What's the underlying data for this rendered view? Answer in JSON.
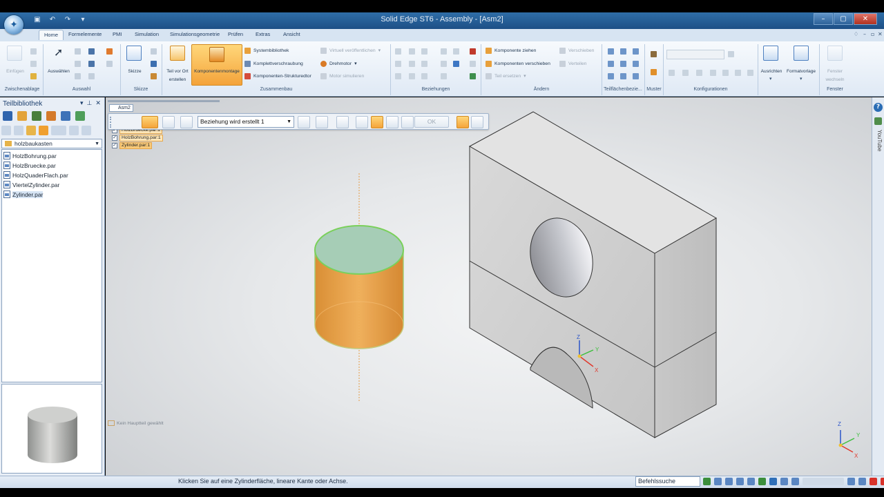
{
  "window": {
    "title": "Solid Edge ST6 - Assembly - [Asm2]",
    "controls": [
      "minimize",
      "maximize",
      "close"
    ]
  },
  "ribbon": {
    "tabs": [
      "Home",
      "Formelemente",
      "PMI",
      "Simulation",
      "Simulationsgeometrie",
      "Prüfen",
      "Extras",
      "Ansicht"
    ],
    "active_tab": "Home",
    "groups": {
      "zwischenablage": {
        "label": "Zwischenablage",
        "paste": "Einfügen"
      },
      "auswahl": {
        "label": "Auswahl",
        "select": "Auswählen"
      },
      "skizze": {
        "label": "Skizze",
        "sketch": "Skizze"
      },
      "zusammenbau": {
        "label": "Zusammenbau",
        "teil_vor_ort_line1": "Teil vor Ort",
        "teil_vor_ort_line2": "erstellen",
        "komponentenmontage": "Komponentenmontage",
        "systembibliothek": "Systembibliothek",
        "komplettverschraubung": "Komplettverschraubung",
        "komponenten_strukturedtor": "Komponenten-Strukturedtor",
        "virtuell": "Virtuell veröffentlichen",
        "drehmotor": "Drehmotor",
        "motor_simulieren": "Motor simulieren"
      },
      "beziehungen": {
        "label": "Beziehungen"
      },
      "aendern": {
        "label": "Ändern",
        "komponente_ziehen": "Komponente ziehen",
        "komponenten_verschieben": "Komponenten verschieben",
        "teil_ersetzen": "Teil ersetzen",
        "verschieben": "Verschieben",
        "verteilen": "Verteilen"
      },
      "teilflaechen": {
        "label": "Teilflächenbezie..."
      },
      "muster": {
        "label": "Muster"
      },
      "konfigurationen": {
        "label": "Konfigurationen"
      },
      "ausrichten": {
        "label": "Ausrichten"
      },
      "formatvorlage": {
        "label": "Formatvorlage"
      },
      "fenster": {
        "label": "Fenster",
        "wechseln_line1": "Fenster",
        "wechseln_line2": "wechseln"
      }
    }
  },
  "library_panel": {
    "title": "Teilbibliothek",
    "folder": "holzbaukasten",
    "files": [
      "HolzBohrung.par",
      "HolzBruecke.par",
      "HolzQuaderFlach.par",
      "ViertelZylinder.par",
      "Zylinder.par"
    ],
    "selected_file": "Zylinder.par"
  },
  "assembly_tree": {
    "root": "Asm2",
    "items": [
      "HolzBruecke.par:1",
      "HolzBohrung.par:1",
      "Zylinder.par:1"
    ]
  },
  "command_bar": {
    "relationship": "Beziehung wird erstellt 1",
    "ok_label": "OK"
  },
  "viewport": {
    "no_main_part": "Kein Hauptteil gewählt",
    "triad_axes": [
      "Z",
      "Y",
      "X"
    ]
  },
  "right_strip": {
    "youtube": "YouTube",
    "help": "?"
  },
  "status": {
    "prompt": "Klicken Sie auf eine Zylinderfläche, lineare Kante oder Achse.",
    "command_search": "Befehlssuche"
  },
  "colors": {
    "cylinder_orange": "#e79a3d",
    "cylinder_top": "#a9d1c0",
    "highlight_green": "#7ad05a",
    "block_gray": "#d4d4d4",
    "title_bar_blue": "#1d4f86",
    "ribbon_active_orange": "#f4a33a"
  }
}
